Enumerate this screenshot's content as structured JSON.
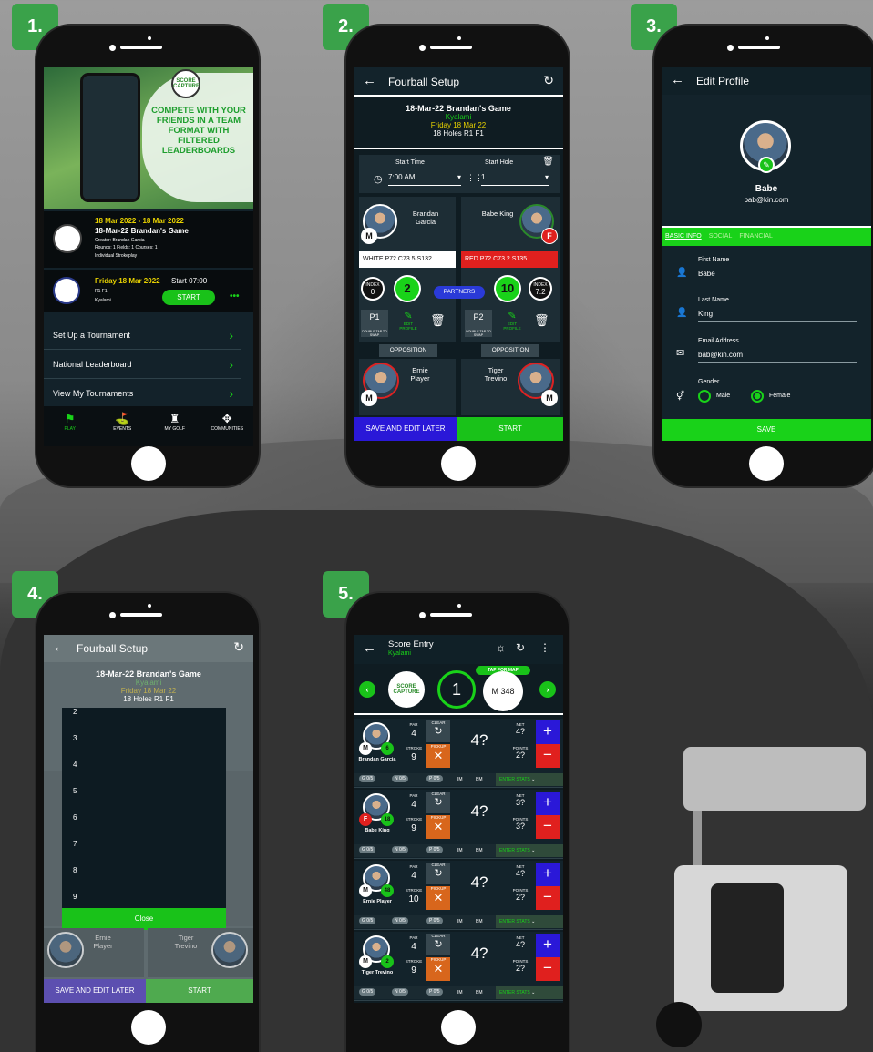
{
  "steps": [
    "1.",
    "2.",
    "3.",
    "4.",
    "5."
  ],
  "s1": {
    "promo": "COMPETE WITH YOUR FRIENDS IN A TEAM FORMAT WITH FILTERED LEADERBOARDS",
    "logo": "SCORE CAPTURE",
    "dates": "18 Mar 2022 - 18 Mar 2022",
    "game": "18-Mar-22 Brandan's Game",
    "creator": "Creator: Brandan Garcia",
    "rounds": "Rounds: 1 Fields: 1 Courses: 1",
    "format": "Individual Strokeplay",
    "round_date": "Friday 18 Mar 2022",
    "start_time": "Start 07:00",
    "round": "R1 F1",
    "course": "Kyalami",
    "start_btn": "START",
    "more": "•••",
    "menu": [
      "Set Up a Tournament",
      "National Leaderboard",
      "View My Tournaments"
    ],
    "tabs": [
      "PLAY",
      "EVENTS",
      "MY GOLF",
      "COMMUNITIES"
    ]
  },
  "s2": {
    "title": "Fourball Setup",
    "game": "18-Mar-22 Brandan's Game",
    "course": "Kyalami",
    "date": "Friday 18 Mar 22",
    "holes": "18 Holes R1 F1",
    "start_time_label": "Start Time",
    "start_hole_label": "Start Hole",
    "time": "7:00 AM",
    "hole": "1",
    "p1_name": "Brandan Garcia",
    "p2_name": "Babe King",
    "p1_tee": "WHITE  P72  C73.5  S132",
    "p2_tee": "RED      P72  C73.2  S135",
    "index_label": "INDEX",
    "p1_index": "0",
    "p2_index": "7.2",
    "p1_hcp": "2",
    "p2_hcp": "10",
    "partners": "PARTNERS",
    "p1": "P1",
    "p2": "P2",
    "swap": "DOUBLE TAP TO SWAP",
    "edit": "EDIT PROFILE",
    "opposition": "OPPOSITION",
    "o1_name": "Ernie Player",
    "o2_name": "Tiger Trevino",
    "save_later": "SAVE AND EDIT LATER",
    "start": "START",
    "gender_m": "M",
    "gender_f": "F"
  },
  "s3": {
    "title": "Edit Profile",
    "name": "Babe",
    "email": "bab@kin.com",
    "tabs": [
      "BASIC INFO",
      "SOCIAL",
      "FINANCIAL"
    ],
    "first_label": "First Name",
    "first_val": "Babe",
    "last_label": "Last Name",
    "last_val": "King",
    "email_label": "Email Address",
    "email_val": "bab@kin.com",
    "gender_label": "Gender",
    "male": "Male",
    "female": "Female",
    "save": "SAVE"
  },
  "s4": {
    "title": "Fourball Setup",
    "game": "18-Mar-22 Brandan's Game",
    "course": "Kyalami",
    "date": "Friday 18 Mar 22",
    "holes": "18 Holes R1 F1",
    "options": [
      "2",
      "3",
      "4",
      "5",
      "6",
      "7",
      "8",
      "9"
    ],
    "close": "Close",
    "o1_name": "Ernie Player",
    "o2_name": "Tiger Trevino",
    "save_later": "SAVE AND EDIT LATER",
    "start": "START"
  },
  "s5": {
    "title": "Score Entry",
    "course": "Kyalami",
    "hole": "1",
    "tap_map": "TAP FOR MAP",
    "distance": "M 348",
    "labels": {
      "par": "PAR",
      "clear": "CLEAR",
      "stroke": "STROKE",
      "pickup": "PICKUP",
      "net": "NET",
      "points": "POINTS",
      "enter": "ENTER STATS",
      "g": "G 0/5",
      "n": "N 0/5",
      "p": "P 0/5",
      "im": "IM",
      "bm": "BM"
    },
    "players": [
      {
        "name": "Brandan Garcia",
        "g": "M",
        "hcp": "6",
        "par": "4",
        "stroke": "9",
        "score": "4?",
        "net": "4?",
        "points": "2?"
      },
      {
        "name": "Babe King",
        "g": "F",
        "hcp": "18",
        "par": "4",
        "stroke": "9",
        "score": "4?",
        "net": "3?",
        "points": "3?"
      },
      {
        "name": "Ernie Player",
        "g": "M",
        "hcp": "48",
        "par": "4",
        "stroke": "10",
        "score": "4?",
        "net": "4?",
        "points": "2?"
      },
      {
        "name": "Tiger Trevino",
        "g": "M",
        "hcp": "2",
        "par": "4",
        "stroke": "9",
        "score": "4?",
        "net": "4?",
        "points": "2?"
      }
    ]
  },
  "colors": {
    "accent": "#19d219",
    "dark": "#102027",
    "step": "#3aa24a",
    "red": "#e0201e",
    "blue": "#2a18d8"
  }
}
